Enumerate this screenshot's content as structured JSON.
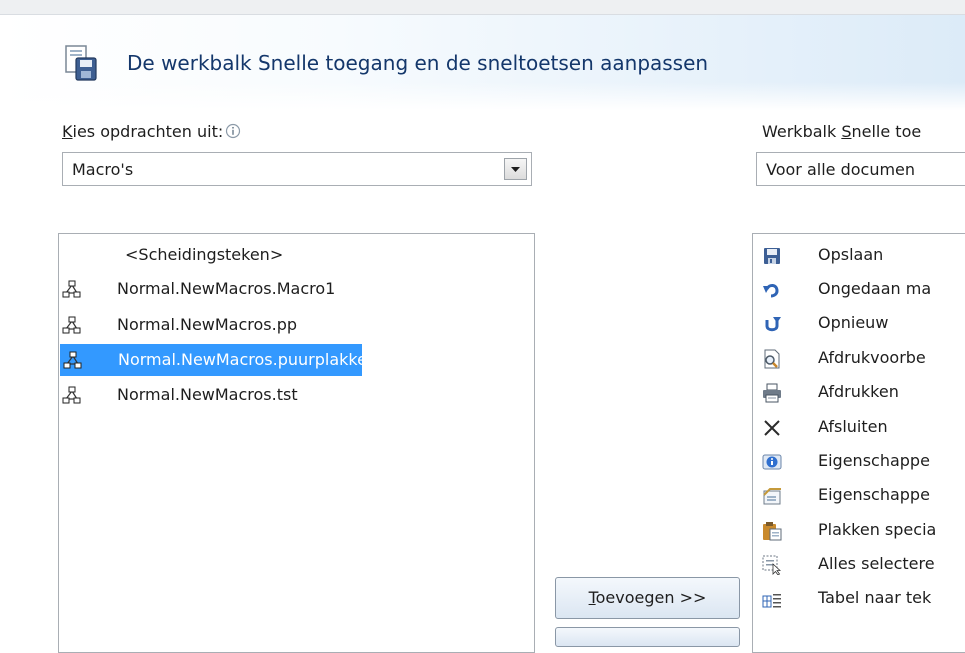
{
  "dialog": {
    "title": "De werkbalk Snelle toegang en de sneltoetsen aanpassen"
  },
  "left": {
    "label_accel": "K",
    "label_rest": "ies opdrachten uit:",
    "dropdown_value": "Macro's",
    "items": [
      {
        "label": "<Scheidingsteken>",
        "icon": "none",
        "selected": false
      },
      {
        "label": "Normal.NewMacros.Macro1",
        "icon": "macro-icon",
        "selected": false
      },
      {
        "label": "Normal.NewMacros.pp",
        "icon": "macro-icon",
        "selected": false
      },
      {
        "label": "Normal.NewMacros.puurplakken",
        "icon": "macro-icon",
        "selected": true
      },
      {
        "label": "Normal.NewMacros.tst",
        "icon": "macro-icon",
        "selected": false
      }
    ]
  },
  "right": {
    "label_pre": "Werkbalk ",
    "label_accel": "S",
    "label_post": "nelle toe",
    "dropdown_value": "Voor alle documen",
    "items": [
      {
        "label": "Opslaan",
        "icon": "save-icon"
      },
      {
        "label": "Ongedaan ma",
        "icon": "undo-icon"
      },
      {
        "label": "Opnieuw",
        "icon": "redo-icon"
      },
      {
        "label": "Afdrukvoorbe",
        "icon": "print-preview-icon"
      },
      {
        "label": "Afdrukken",
        "icon": "printer-icon"
      },
      {
        "label": "Afsluiten",
        "icon": "close-icon"
      },
      {
        "label": "Eigenschappe",
        "icon": "info-properties-icon"
      },
      {
        "label": "Eigenschappe",
        "icon": "document-properties-icon"
      },
      {
        "label": "Plakken specia",
        "icon": "paste-special-icon"
      },
      {
        "label": "Alles selectere",
        "icon": "select-all-icon"
      },
      {
        "label": "Tabel naar tek",
        "icon": "table-to-text-icon"
      }
    ]
  },
  "buttons": {
    "add_accel": "T",
    "add_rest": "oevoegen >>"
  },
  "colors": {
    "selection": "#3399ff",
    "title": "#14376b"
  }
}
